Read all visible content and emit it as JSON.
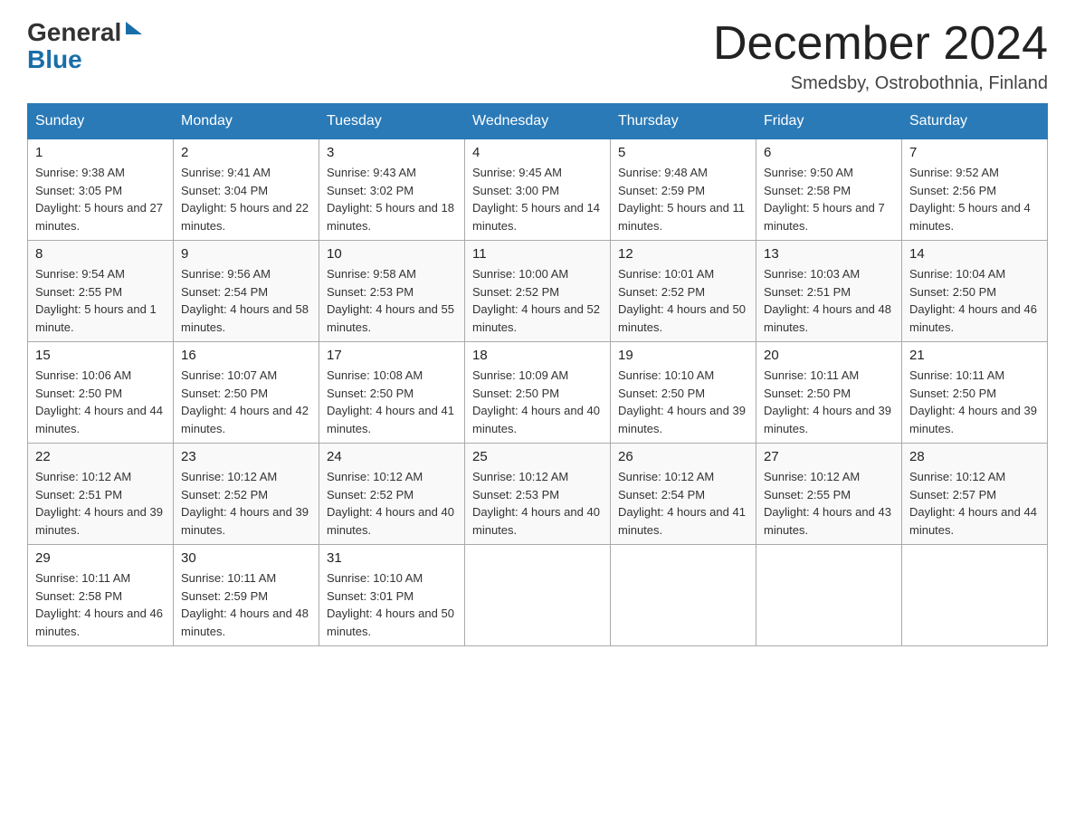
{
  "logo": {
    "text1": "General",
    "text2": "Blue"
  },
  "title": "December 2024",
  "subtitle": "Smedsby, Ostrobothnia, Finland",
  "days_of_week": [
    "Sunday",
    "Monday",
    "Tuesday",
    "Wednesday",
    "Thursday",
    "Friday",
    "Saturday"
  ],
  "weeks": [
    [
      {
        "day": "1",
        "sunrise": "9:38 AM",
        "sunset": "3:05 PM",
        "daylight": "5 hours and 27 minutes."
      },
      {
        "day": "2",
        "sunrise": "9:41 AM",
        "sunset": "3:04 PM",
        "daylight": "5 hours and 22 minutes."
      },
      {
        "day": "3",
        "sunrise": "9:43 AM",
        "sunset": "3:02 PM",
        "daylight": "5 hours and 18 minutes."
      },
      {
        "day": "4",
        "sunrise": "9:45 AM",
        "sunset": "3:00 PM",
        "daylight": "5 hours and 14 minutes."
      },
      {
        "day": "5",
        "sunrise": "9:48 AM",
        "sunset": "2:59 PM",
        "daylight": "5 hours and 11 minutes."
      },
      {
        "day": "6",
        "sunrise": "9:50 AM",
        "sunset": "2:58 PM",
        "daylight": "5 hours and 7 minutes."
      },
      {
        "day": "7",
        "sunrise": "9:52 AM",
        "sunset": "2:56 PM",
        "daylight": "5 hours and 4 minutes."
      }
    ],
    [
      {
        "day": "8",
        "sunrise": "9:54 AM",
        "sunset": "2:55 PM",
        "daylight": "5 hours and 1 minute."
      },
      {
        "day": "9",
        "sunrise": "9:56 AM",
        "sunset": "2:54 PM",
        "daylight": "4 hours and 58 minutes."
      },
      {
        "day": "10",
        "sunrise": "9:58 AM",
        "sunset": "2:53 PM",
        "daylight": "4 hours and 55 minutes."
      },
      {
        "day": "11",
        "sunrise": "10:00 AM",
        "sunset": "2:52 PM",
        "daylight": "4 hours and 52 minutes."
      },
      {
        "day": "12",
        "sunrise": "10:01 AM",
        "sunset": "2:52 PM",
        "daylight": "4 hours and 50 minutes."
      },
      {
        "day": "13",
        "sunrise": "10:03 AM",
        "sunset": "2:51 PM",
        "daylight": "4 hours and 48 minutes."
      },
      {
        "day": "14",
        "sunrise": "10:04 AM",
        "sunset": "2:50 PM",
        "daylight": "4 hours and 46 minutes."
      }
    ],
    [
      {
        "day": "15",
        "sunrise": "10:06 AM",
        "sunset": "2:50 PM",
        "daylight": "4 hours and 44 minutes."
      },
      {
        "day": "16",
        "sunrise": "10:07 AM",
        "sunset": "2:50 PM",
        "daylight": "4 hours and 42 minutes."
      },
      {
        "day": "17",
        "sunrise": "10:08 AM",
        "sunset": "2:50 PM",
        "daylight": "4 hours and 41 minutes."
      },
      {
        "day": "18",
        "sunrise": "10:09 AM",
        "sunset": "2:50 PM",
        "daylight": "4 hours and 40 minutes."
      },
      {
        "day": "19",
        "sunrise": "10:10 AM",
        "sunset": "2:50 PM",
        "daylight": "4 hours and 39 minutes."
      },
      {
        "day": "20",
        "sunrise": "10:11 AM",
        "sunset": "2:50 PM",
        "daylight": "4 hours and 39 minutes."
      },
      {
        "day": "21",
        "sunrise": "10:11 AM",
        "sunset": "2:50 PM",
        "daylight": "4 hours and 39 minutes."
      }
    ],
    [
      {
        "day": "22",
        "sunrise": "10:12 AM",
        "sunset": "2:51 PM",
        "daylight": "4 hours and 39 minutes."
      },
      {
        "day": "23",
        "sunrise": "10:12 AM",
        "sunset": "2:52 PM",
        "daylight": "4 hours and 39 minutes."
      },
      {
        "day": "24",
        "sunrise": "10:12 AM",
        "sunset": "2:52 PM",
        "daylight": "4 hours and 40 minutes."
      },
      {
        "day": "25",
        "sunrise": "10:12 AM",
        "sunset": "2:53 PM",
        "daylight": "4 hours and 40 minutes."
      },
      {
        "day": "26",
        "sunrise": "10:12 AM",
        "sunset": "2:54 PM",
        "daylight": "4 hours and 41 minutes."
      },
      {
        "day": "27",
        "sunrise": "10:12 AM",
        "sunset": "2:55 PM",
        "daylight": "4 hours and 43 minutes."
      },
      {
        "day": "28",
        "sunrise": "10:12 AM",
        "sunset": "2:57 PM",
        "daylight": "4 hours and 44 minutes."
      }
    ],
    [
      {
        "day": "29",
        "sunrise": "10:11 AM",
        "sunset": "2:58 PM",
        "daylight": "4 hours and 46 minutes."
      },
      {
        "day": "30",
        "sunrise": "10:11 AM",
        "sunset": "2:59 PM",
        "daylight": "4 hours and 48 minutes."
      },
      {
        "day": "31",
        "sunrise": "10:10 AM",
        "sunset": "3:01 PM",
        "daylight": "4 hours and 50 minutes."
      },
      null,
      null,
      null,
      null
    ]
  ]
}
